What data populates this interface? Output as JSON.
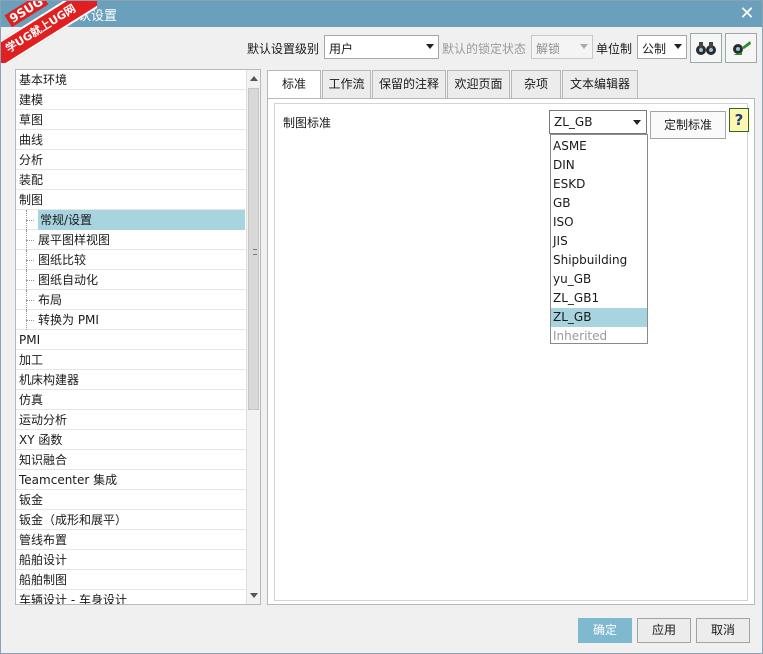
{
  "window": {
    "title": "默认设置",
    "close_glyph": "✕",
    "badge": {
      "top": "9SUG",
      "ribbon": "学UG就上UG网"
    }
  },
  "toolbar": {
    "level_label": "默认设置级别",
    "level_value": "用户",
    "lock_label": "默认的锁定状态",
    "lock_value": "解锁",
    "unit_label": "单位制",
    "unit_value": "公制",
    "icons": [
      "binoculars-icon",
      "import-export-icon"
    ]
  },
  "tree": {
    "items": [
      {
        "label": "基本环境",
        "level": 0
      },
      {
        "label": "建模",
        "level": 0
      },
      {
        "label": "草图",
        "level": 0
      },
      {
        "label": "曲线",
        "level": 0
      },
      {
        "label": "分析",
        "level": 0
      },
      {
        "label": "装配",
        "level": 0
      },
      {
        "label": "制图",
        "level": 0
      },
      {
        "label": "常规/设置",
        "level": 1,
        "selected": true
      },
      {
        "label": "展平图样视图",
        "level": 1
      },
      {
        "label": "图纸比较",
        "level": 1
      },
      {
        "label": "图纸自动化",
        "level": 1
      },
      {
        "label": "布局",
        "level": 1
      },
      {
        "label": "转换为 PMI",
        "level": 1
      },
      {
        "label": "PMI",
        "level": 0
      },
      {
        "label": "加工",
        "level": 0
      },
      {
        "label": "机床构建器",
        "level": 0
      },
      {
        "label": "仿真",
        "level": 0
      },
      {
        "label": "运动分析",
        "level": 0
      },
      {
        "label": "XY 函数",
        "level": 0
      },
      {
        "label": "知识融合",
        "level": 0
      },
      {
        "label": "Teamcenter 集成",
        "level": 0
      },
      {
        "label": "钣金",
        "level": 0
      },
      {
        "label": "钣金（成形和展平）",
        "level": 0
      },
      {
        "label": "管线布置",
        "level": 0
      },
      {
        "label": "船舶设计",
        "level": 0
      },
      {
        "label": "船舶制图",
        "level": 0
      },
      {
        "label": "车辆设计 - 车身设计",
        "level": 0
      }
    ]
  },
  "tabs": [
    {
      "label": "标准",
      "active": true
    },
    {
      "label": "工作流"
    },
    {
      "label": "保留的注释"
    },
    {
      "label": "欢迎页面"
    },
    {
      "label": "杂项"
    },
    {
      "label": "文本编辑器"
    }
  ],
  "panel": {
    "field_label": "制图标准",
    "standard_value": "ZL_GB",
    "custom_button": "定制标准",
    "help_glyph": "?",
    "options": [
      {
        "label": "ASME"
      },
      {
        "label": "DIN"
      },
      {
        "label": "ESKD"
      },
      {
        "label": "GB"
      },
      {
        "label": "ISO"
      },
      {
        "label": "JIS"
      },
      {
        "label": "Shipbuilding"
      },
      {
        "label": "yu_GB"
      },
      {
        "label": "ZL_GB1"
      },
      {
        "label": "ZL_GB",
        "selected": true
      },
      {
        "label": "Inherited",
        "disabled": true
      }
    ]
  },
  "buttons": {
    "ok": "确定",
    "apply": "应用",
    "cancel": "取消"
  },
  "colors": {
    "titlebar": "#6aa0bb",
    "selection": "#a8d4e0",
    "primary_button": "#7fb9cf",
    "badge": "#e02020"
  }
}
